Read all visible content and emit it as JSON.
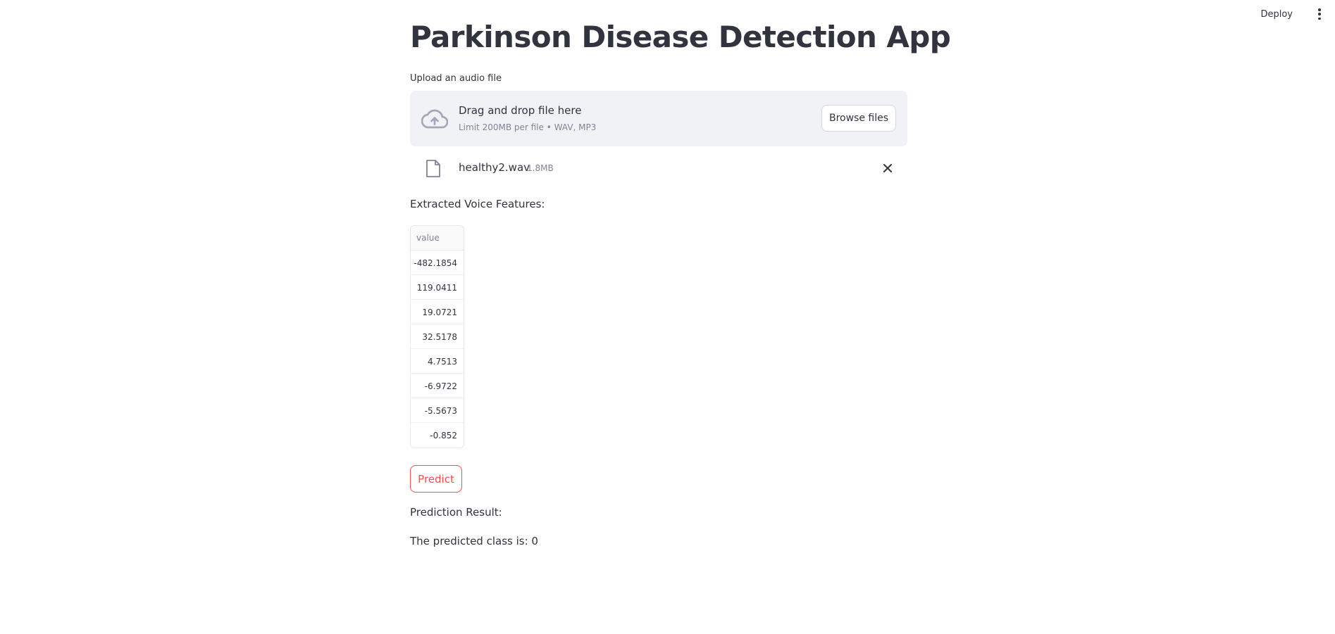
{
  "header": {
    "deploy_label": "Deploy",
    "menu_icon": "kebab-menu-icon"
  },
  "main": {
    "title": "Parkinson Disease Detection App",
    "uploader": {
      "label": "Upload an audio file",
      "drop_title": "Drag and drop file here",
      "drop_subtitle": "Limit 200MB per file • WAV, MP3",
      "browse_label": "Browse files",
      "icon": "cloud-upload-icon"
    },
    "uploaded_file": {
      "name": "healthy2.wav",
      "size": "1.8MB",
      "icon": "file-icon",
      "remove_icon": "close-icon"
    },
    "features": {
      "label": "Extracted Voice Features:",
      "column_header": "value",
      "rows": [
        "-482.1854",
        "119.0411",
        "19.0721",
        "32.5178",
        "4.7513",
        "-6.9722",
        "-5.5673",
        "-0.852"
      ]
    },
    "predict_label": "Predict",
    "result": {
      "label": "Prediction Result:",
      "text": "The predicted class is: 0"
    }
  },
  "colors": {
    "accent": "#ff4b4b",
    "text": "#31333f",
    "muted": "#808495",
    "dropzone_bg": "#f0f2f6"
  }
}
